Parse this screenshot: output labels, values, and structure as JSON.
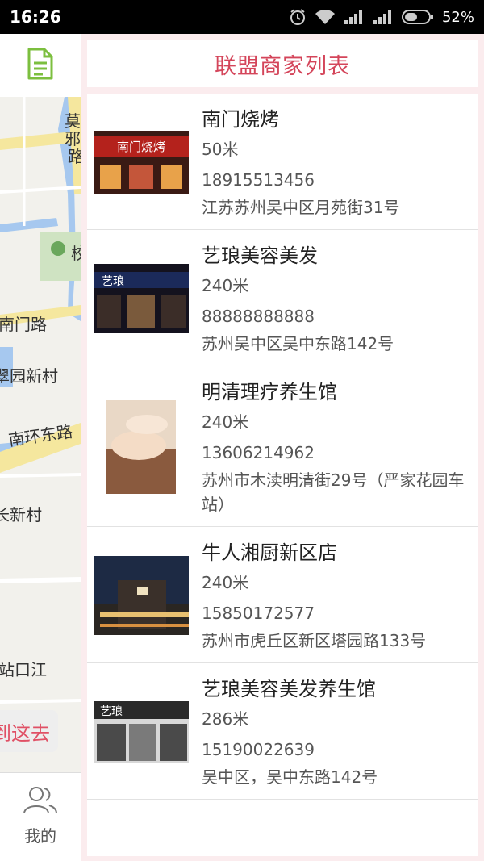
{
  "status_bar": {
    "time": "16:26",
    "battery": "52%"
  },
  "map": {
    "labels": [
      "莫",
      "邪",
      "路",
      "校",
      "南门路",
      "翠园新村",
      "南环东路",
      "长新村",
      "站口江"
    ],
    "go_button": "到这去",
    "bottom_nav_label": "我的"
  },
  "list": {
    "title": "联盟商家列表",
    "merchants": [
      {
        "name": "南门烧烤",
        "distance": "50米",
        "phone": "18915513456",
        "address": "江苏苏州吴中区月苑街31号",
        "image_text": "南门烧烤"
      },
      {
        "name": "艺琅美容美发",
        "distance": "240米",
        "phone": "88888888888",
        "address": "苏州吴中区吴中东路142号",
        "image_text": "艺琅"
      },
      {
        "name": "明清理疗养生馆",
        "distance": "240米",
        "phone": "13606214962",
        "address": "苏州市木渎明清街29号（严家花园车站）"
      },
      {
        "name": "牛人湘厨新区店",
        "distance": "240米",
        "phone": "15850172577",
        "address": "苏州市虎丘区新区塔园路133号"
      },
      {
        "name": "艺琅美容美发养生馆",
        "distance": "286米",
        "phone": "15190022639",
        "address": "吴中区，吴中东路142号",
        "image_text": "艺琅"
      }
    ]
  },
  "colors": {
    "accent": "#d4455a",
    "header_bg": "#fbecee",
    "road_yellow": "#f5e79e",
    "water": "#a6c8ef",
    "icon_green": "#7cbf3f"
  },
  "icons": [
    "document-icon",
    "user-group-icon",
    "alarm-icon",
    "wifi-icon",
    "signal-icon",
    "battery-icon"
  ]
}
